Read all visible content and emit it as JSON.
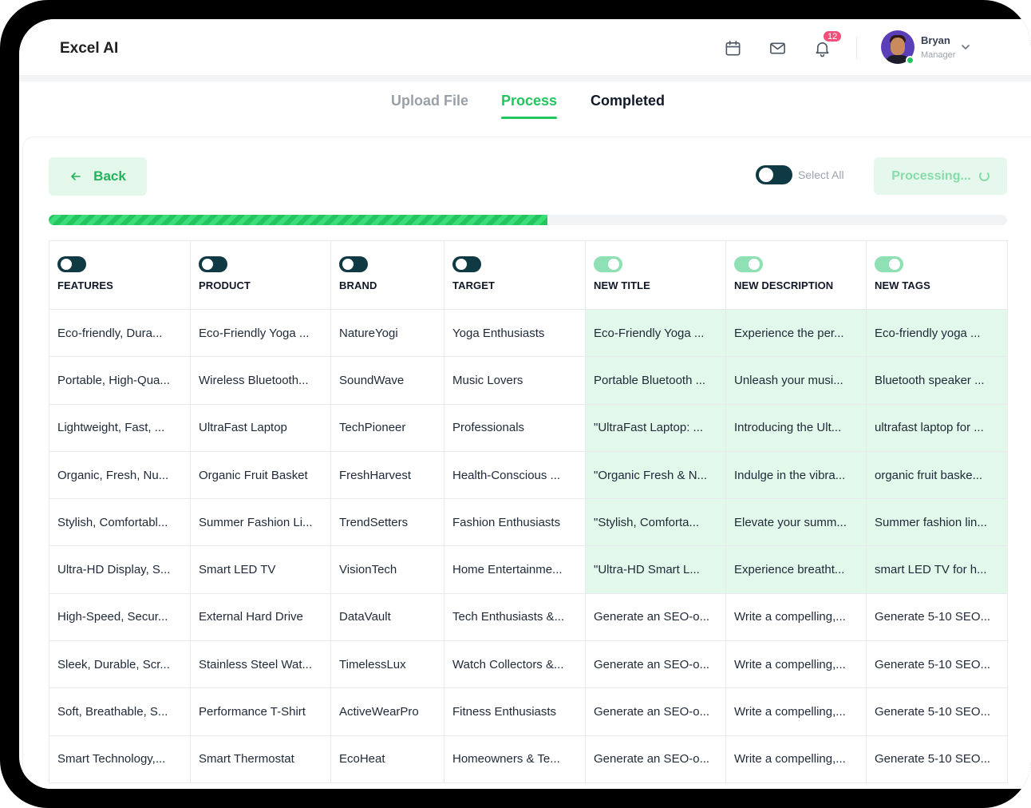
{
  "app": {
    "title": "Excel AI"
  },
  "header": {
    "notification_count": "12",
    "user": {
      "name": "Bryan",
      "role": "Manager"
    }
  },
  "steps": [
    {
      "label": "Upload File",
      "state": "done"
    },
    {
      "label": "Process",
      "state": "active"
    },
    {
      "label": "Completed",
      "state": "upcoming"
    }
  ],
  "toolbar": {
    "back_label": "Back",
    "select_all_label": "Select All",
    "processing_label": "Processing..."
  },
  "progress": {
    "fraction": 0.52
  },
  "colors": {
    "accent": "#22c55e",
    "toggle_off": "#0f3a44",
    "toggle_on": "#8fe0b4",
    "generated_bg": "#e1f8ea",
    "badge": "#f0507a"
  },
  "table": {
    "columns": [
      {
        "label": "FEATURES",
        "enabled": false
      },
      {
        "label": "PRODUCT",
        "enabled": false
      },
      {
        "label": "BRAND",
        "enabled": false
      },
      {
        "label": "TARGET",
        "enabled": false
      },
      {
        "label": "NEW TITLE",
        "enabled": true
      },
      {
        "label": "NEW DESCRIPTION",
        "enabled": true
      },
      {
        "label": "NEW TAGS",
        "enabled": true
      }
    ],
    "rows": [
      {
        "generated": true,
        "cells": [
          "Eco-friendly, Dura...",
          "Eco-Friendly Yoga ...",
          "NatureYogi",
          "Yoga Enthusiasts",
          "Eco-Friendly Yoga ...",
          "Experience the per...",
          "Eco-friendly yoga ..."
        ]
      },
      {
        "generated": true,
        "cells": [
          "Portable, High-Qua...",
          "Wireless Bluetooth...",
          "SoundWave",
          "Music Lovers",
          "Portable Bluetooth ...",
          "Unleash your musi...",
          "Bluetooth speaker ..."
        ]
      },
      {
        "generated": true,
        "cells": [
          "Lightweight, Fast, ...",
          "UltraFast Laptop",
          "TechPioneer",
          "Professionals",
          "\"UltraFast Laptop: ...",
          "Introducing the Ult...",
          "ultrafast laptop for ..."
        ]
      },
      {
        "generated": true,
        "cells": [
          "Organic, Fresh, Nu...",
          "Organic Fruit Basket",
          "FreshHarvest",
          "Health-Conscious ...",
          "\"Organic Fresh & N...",
          "Indulge in the vibra...",
          "organic fruit baske..."
        ]
      },
      {
        "generated": true,
        "cells": [
          "Stylish, Comfortabl...",
          "Summer Fashion Li...",
          "TrendSetters",
          "Fashion Enthusiasts",
          "\"Stylish, Comforta...",
          "Elevate your summ...",
          "Summer fashion lin..."
        ]
      },
      {
        "generated": true,
        "cells": [
          "Ultra-HD Display, S...",
          "Smart LED TV",
          "VisionTech",
          "Home Entertainme...",
          "\"Ultra-HD Smart L...",
          "Experience breatht...",
          "smart LED TV for h..."
        ]
      },
      {
        "generated": false,
        "cells": [
          "High-Speed, Secur...",
          "External Hard Drive",
          "DataVault",
          "Tech Enthusiasts &...",
          "Generate an SEO-o...",
          "Write a compelling,...",
          "Generate 5-10 SEO..."
        ]
      },
      {
        "generated": false,
        "cells": [
          "Sleek, Durable, Scr...",
          "Stainless Steel Wat...",
          "TimelessLux",
          "Watch Collectors &...",
          "Generate an SEO-o...",
          "Write a compelling,...",
          "Generate 5-10 SEO..."
        ]
      },
      {
        "generated": false,
        "cells": [
          "Soft, Breathable, S...",
          "Performance T-Shirt",
          "ActiveWearPro",
          "Fitness Enthusiasts",
          "Generate an SEO-o...",
          "Write a compelling,...",
          "Generate 5-10 SEO..."
        ]
      },
      {
        "generated": false,
        "cells": [
          "Smart Technology,...",
          "Smart Thermostat",
          "EcoHeat",
          "Homeowners & Te...",
          "Generate an SEO-o...",
          "Write a compelling,...",
          "Generate 5-10 SEO..."
        ]
      }
    ]
  }
}
